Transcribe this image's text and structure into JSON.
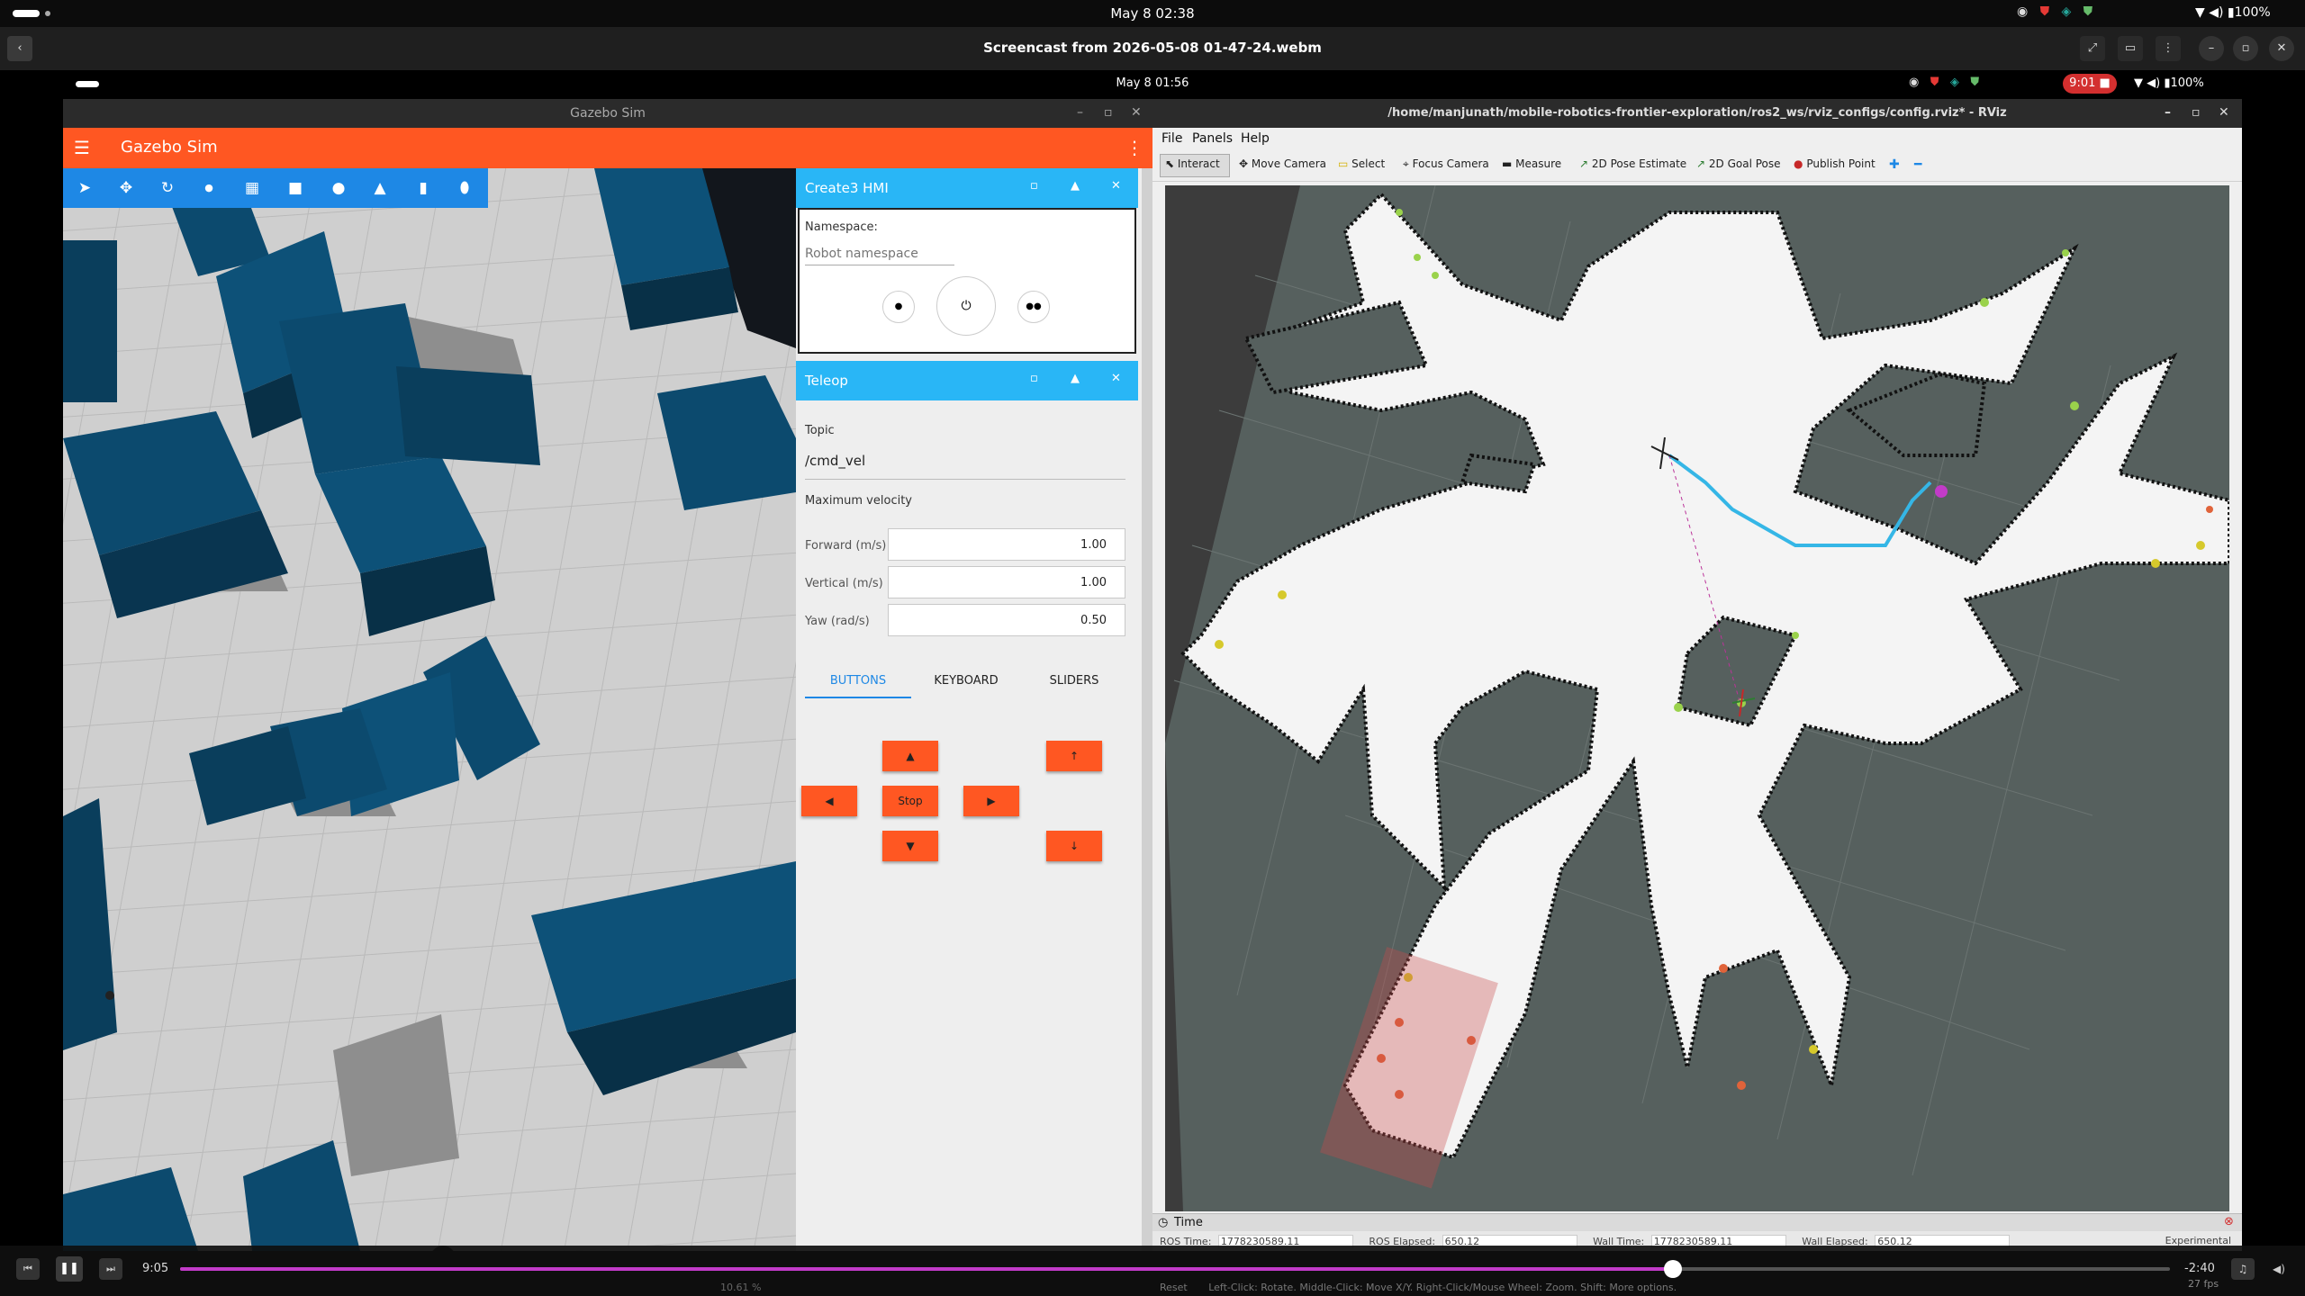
{
  "system_bar": {
    "datetime": "May 8  02:38",
    "battery": "100%"
  },
  "player": {
    "title": "Screencast from 2026-05-08 01-47-24.webm",
    "current_time": "9:05",
    "remaining_time": "-2:40",
    "progress": 0.75
  },
  "inner_bar": {
    "datetime": "May 8  01:56",
    "record_time": "9:01",
    "battery": "100%"
  },
  "gazebo": {
    "window_title": "Gazebo Sim",
    "app_title": "Gazebo Sim",
    "hmi": {
      "panel_title": "Create3 HMI",
      "namespace_label": "Namespace:",
      "namespace_placeholder": "Robot namespace"
    },
    "teleop": {
      "panel_title": "Teleop",
      "topic_label": "Topic",
      "topic_value": "/cmd_vel",
      "max_velocity_label": "Maximum velocity",
      "forward_label": "Forward (m/s)",
      "forward_value": "1.00",
      "vertical_label": "Vertical (m/s)",
      "vertical_value": "1.00",
      "yaw_label": "Yaw (rad/s)",
      "yaw_value": "0.50",
      "tabs": [
        "BUTTONS",
        "KEYBOARD",
        "SLIDERS"
      ],
      "active_tab": "BUTTONS",
      "stop_label": "Stop",
      "up_arrow": "▲",
      "down_arrow": "▼",
      "left_arrow": "◀",
      "right_arrow": "▶",
      "vert_up": "↑",
      "vert_down": "↓"
    }
  },
  "rviz": {
    "window_title": "/home/manjunath/mobile-robotics-frontier-exploration/ros2_ws/rviz_configs/config.rviz* - RViz",
    "menu": [
      "File",
      "Panels",
      "Help"
    ],
    "tools": [
      "Interact",
      "Move Camera",
      "Select",
      "Focus Camera",
      "Measure",
      "2D Pose Estimate",
      "2D Goal Pose",
      "Publish Point"
    ],
    "time_panel_title": "Time",
    "ros_time_label": "ROS Time:",
    "ros_time_value": "1778230589.11",
    "ros_elapsed_label": "ROS Elapsed:",
    "ros_elapsed_value": "650.12",
    "wall_time_label": "Wall Time:",
    "wall_time_value": "1778230589.11",
    "wall_elapsed_label": "Wall Elapsed:",
    "wall_elapsed_value": "650.12",
    "experimental_label": "Experimental",
    "fps": "27 fps",
    "reset_label": "Reset",
    "hint_text": "Left-Click: Rotate.  Middle-Click: Move X/Y.  Right-Click/Mouse Wheel: Zoom.  Shift: More options.",
    "footer_rtf": "10.61 %"
  }
}
